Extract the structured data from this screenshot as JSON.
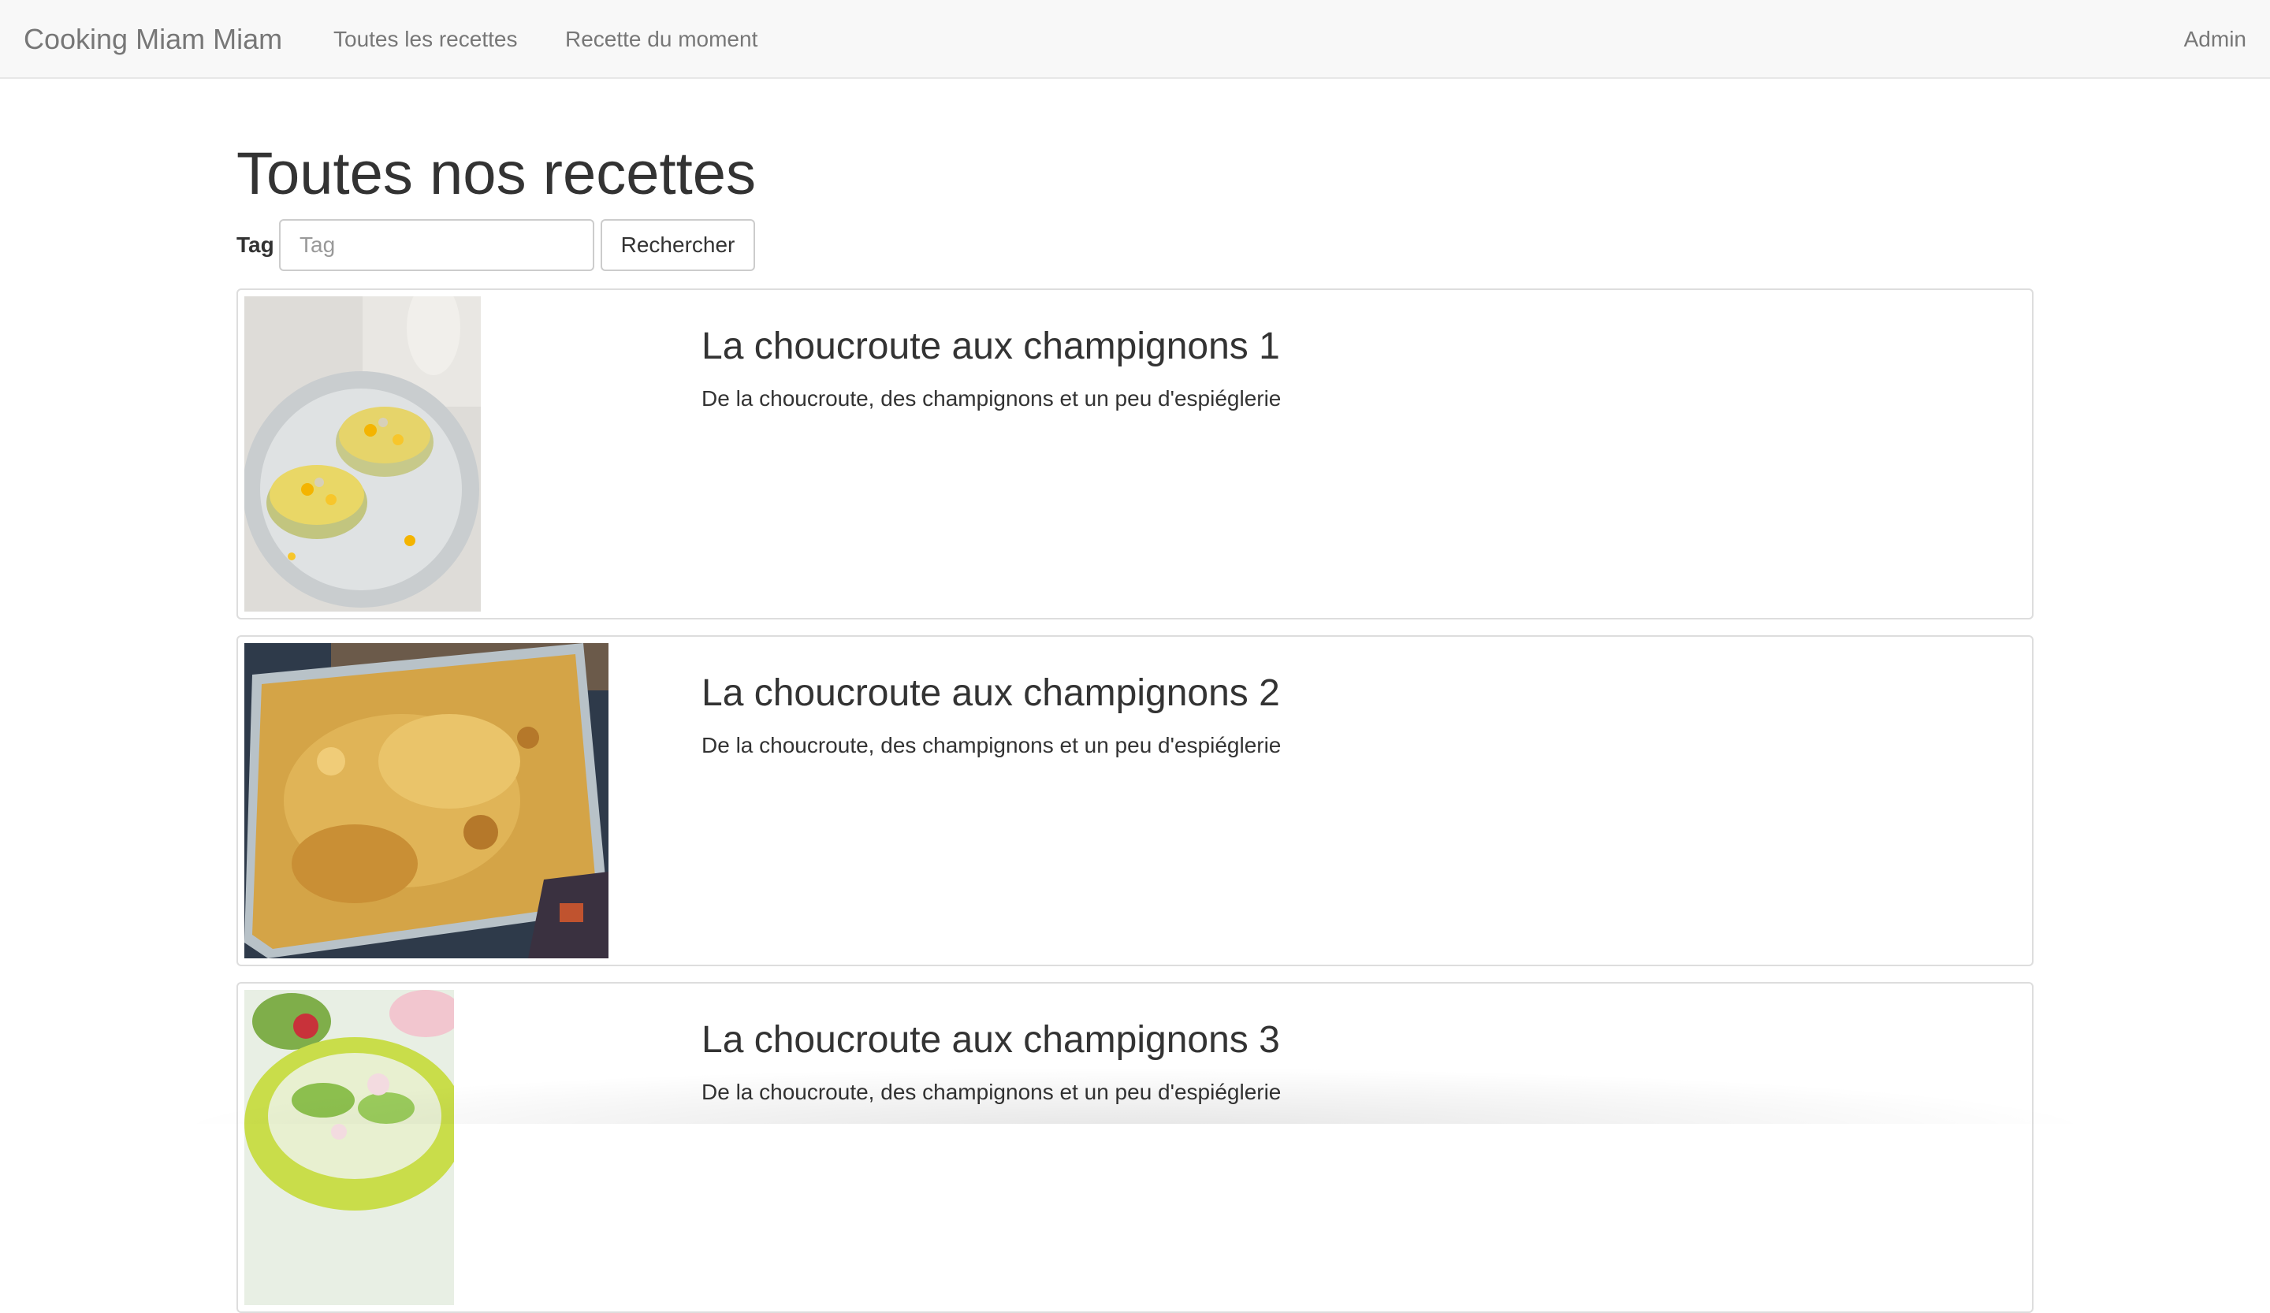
{
  "navbar": {
    "brand": "Cooking Miam Miam",
    "links": [
      {
        "label": "Toutes les recettes"
      },
      {
        "label": "Recette du moment"
      }
    ],
    "admin": "Admin"
  },
  "page": {
    "title": "Toutes nos recettes"
  },
  "search": {
    "label": "Tag",
    "placeholder": "Tag",
    "value": "",
    "button_label": "Rechercher"
  },
  "recipes": [
    {
      "title": "La choucroute aux champignons 1",
      "description": "De la choucroute, des champignons et un peu d'espiéglerie",
      "image": "stuffed-dish-plate-photo"
    },
    {
      "title": "La choucroute aux champignons 2",
      "description": "De la choucroute, des champignons et un peu d'espiéglerie",
      "image": "gratin-baking-dish-photo"
    },
    {
      "title": "La choucroute aux champignons 3",
      "description": "De la choucroute, des champignons et un peu d'espiéglerie",
      "image": "salad-bowl-photo"
    }
  ],
  "colors": {
    "navbar_bg": "#f8f8f8",
    "nav_text": "#777777",
    "text": "#333333",
    "border": "#dddddd"
  }
}
